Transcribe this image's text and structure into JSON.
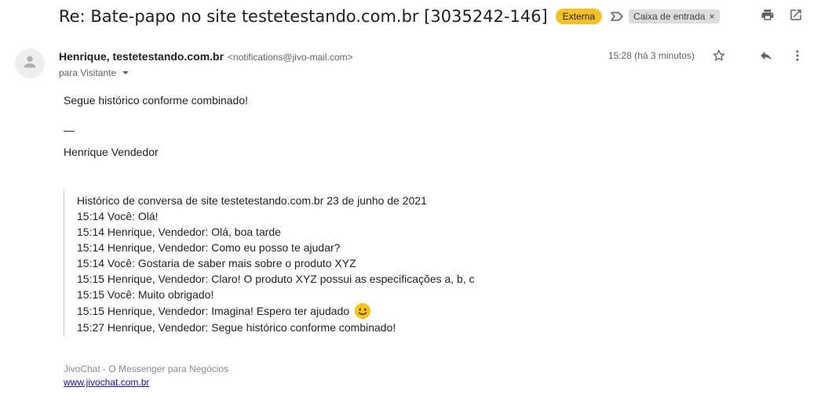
{
  "email": {
    "subject": "Re: Bate-papo no site testetestando.com.br [3035242-146]",
    "badge_external": "Externa",
    "inbox_label": "Caixa de entrada",
    "inbox_label_remove": "×",
    "sender_name": "Henrique, testetestando.com.br",
    "sender_email": "<notifications@jivo-mail.com>",
    "recipient": "para Visitante",
    "timestamp": "15:28 (há 3 minutos)"
  },
  "body": {
    "intro": "Segue histórico conforme combinado!",
    "separator": "—",
    "signature": "Henrique Vendedor"
  },
  "history": {
    "lines": [
      "Histórico de conversa de site testetestando.com.br 23 de junho de 2021",
      "15:14 Você: Olá!",
      "15:14 Henrique, Vendedor: Olá, boa tarde",
      "15:14 Henrique, Vendedor: Como eu posso te ajudar?",
      "15:14 Você: Gostaria de saber mais sobre o produto XYZ",
      "15:15 Henrique, Vendedor: Claro! O produto XYZ possui as especificações a, b, c",
      "15:15 Você: Muito obrigado!",
      "15:15 Henrique, Vendedor: Imagina! Espero ter ajudado",
      "15:27 Henrique, Vendedor: Segue histórico conforme combinado!"
    ]
  },
  "footer": {
    "brand": "JivoChat - O Messenger para Negócios",
    "link": "www.jivochat.com.br"
  },
  "colors": {
    "badge_external": "#f6c026",
    "inbox_chip": "#dddddd",
    "link": "#1a0dab",
    "emoji": "#f8c21c"
  },
  "icons": [
    "label-arrow-icon",
    "print-icon",
    "open-new-window-icon",
    "avatar-person-icon",
    "star-icon",
    "reply-icon",
    "more-vert-icon",
    "caret-down-icon",
    "smiley-emoji-icon"
  ]
}
